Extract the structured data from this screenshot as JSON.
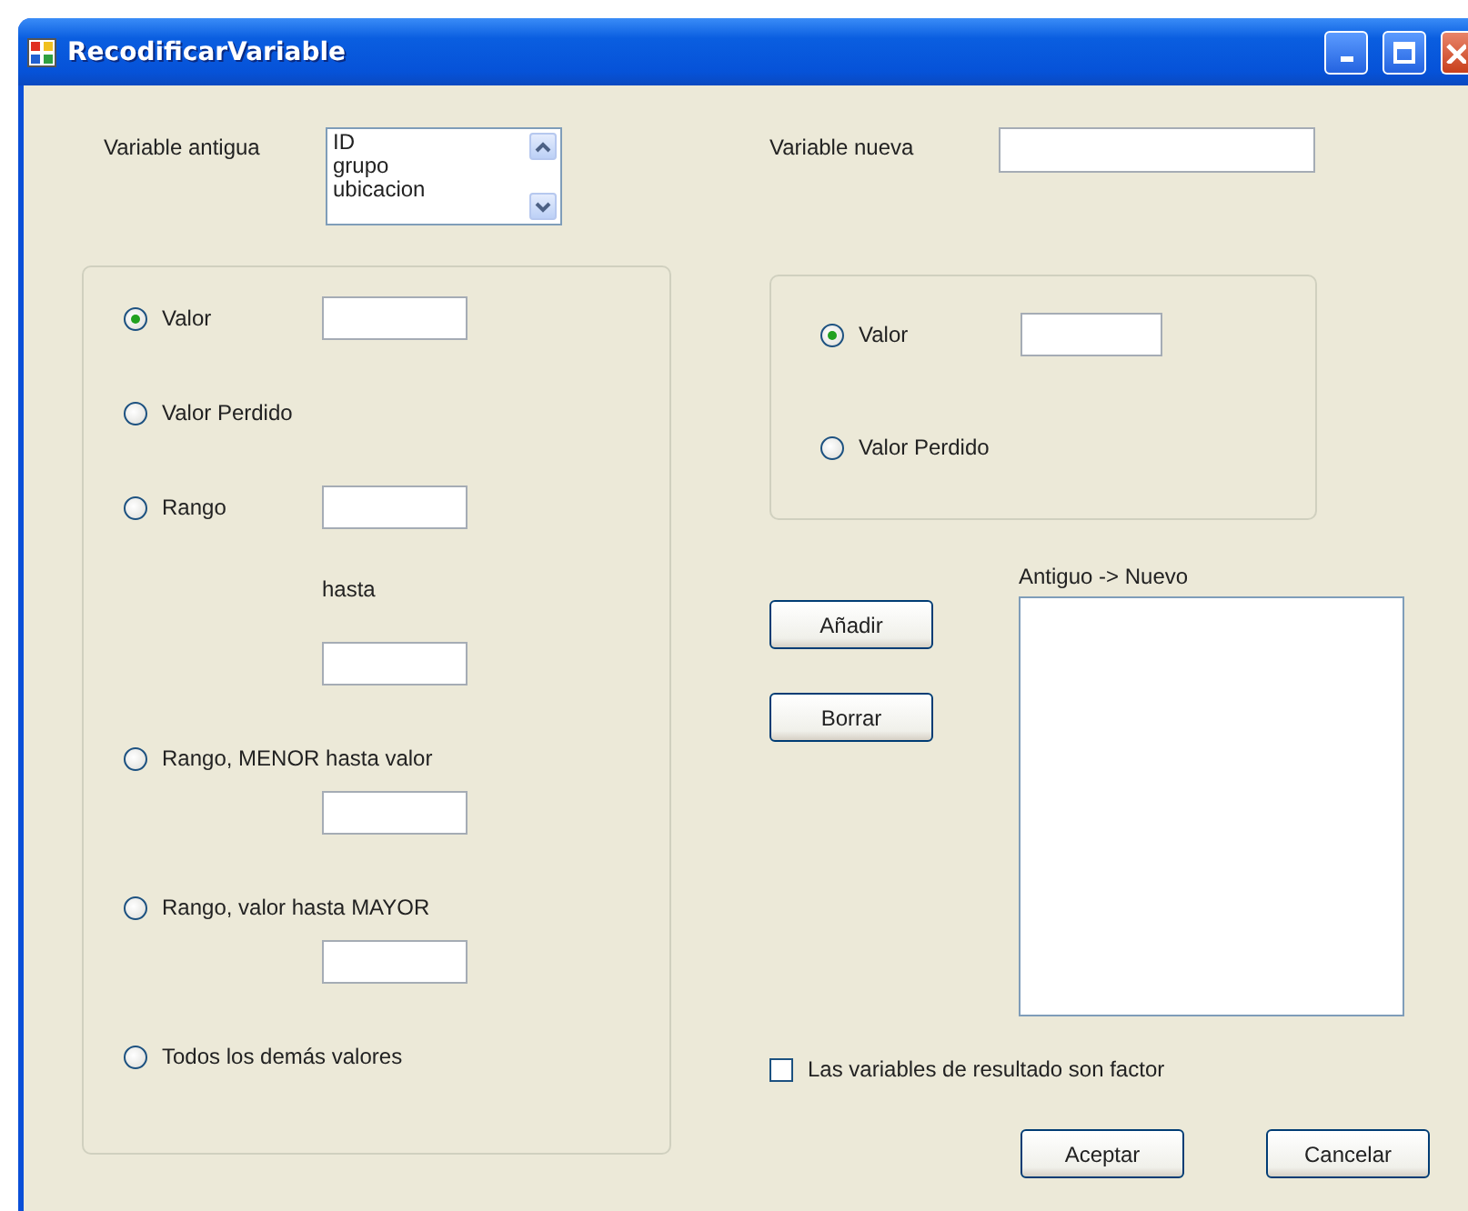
{
  "window": {
    "title": "RecodificarVariable"
  },
  "old_variable": {
    "label": "Variable antigua",
    "items": [
      "ID",
      "grupo",
      "ubicacion"
    ]
  },
  "new_variable": {
    "label": "Variable nueva"
  },
  "old_values": {
    "options": [
      {
        "kind": "input",
        "label": "Valor",
        "selected": true
      },
      {
        "kind": "plain",
        "label": "Valor Perdido",
        "selected": false
      },
      {
        "kind": "range",
        "label": "Rango",
        "between": "hasta",
        "selected": false
      },
      {
        "kind": "input_below",
        "label": "Rango, MENOR hasta valor",
        "selected": false
      },
      {
        "kind": "input_below",
        "label": "Rango, valor hasta MAYOR",
        "selected": false
      },
      {
        "kind": "plain",
        "label": "Todos los demás valores",
        "selected": false
      }
    ]
  },
  "new_value": {
    "options": [
      {
        "kind": "input",
        "label": "Valor",
        "selected": true
      },
      {
        "kind": "plain",
        "label": "Valor Perdido",
        "selected": false
      }
    ]
  },
  "edit_buttons": [
    "Añadir",
    "Borrar"
  ],
  "mapping_list": {
    "label": "Antiguo -> Nuevo"
  },
  "factor_checkbox": {
    "label": "Las variables de resultado son factor",
    "checked": false
  },
  "dialog_buttons": [
    "Aceptar",
    "Cancelar"
  ]
}
